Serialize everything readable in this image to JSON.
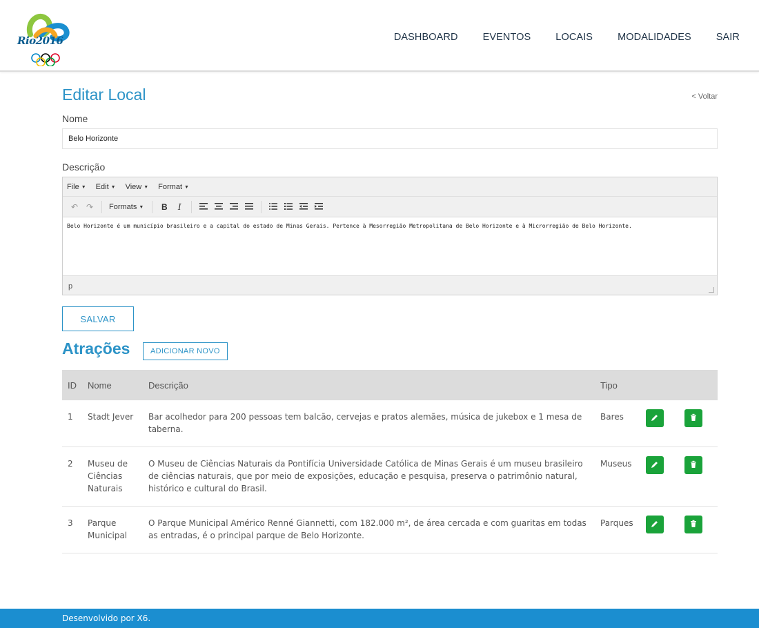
{
  "header": {
    "logo_text": "Rio2016",
    "nav": [
      "DASHBOARD",
      "EVENTOS",
      "LOCAIS",
      "MODALIDADES",
      "SAIR"
    ]
  },
  "page": {
    "title": "Editar Local",
    "back_label": "< Voltar"
  },
  "form": {
    "name_label": "Nome",
    "name_value": "Belo Horizonte",
    "description_label": "Descrição",
    "save_label": "SALVAR"
  },
  "editor": {
    "menus": [
      "File",
      "Edit",
      "View",
      "Format"
    ],
    "formats_label": "Formats",
    "bold_label": "B",
    "italic_label": "I",
    "content": "Belo Horizonte é um município brasileiro e a capital do estado de Minas Gerais. Pertence à Mesorregião Metropolitana de Belo Horizonte e à Microrregião de Belo Horizonte.",
    "status_path": "p"
  },
  "attractions": {
    "title": "Atrações",
    "add_label": "ADICIONAR NOVO",
    "columns": [
      "ID",
      "Nome",
      "Descrição",
      "Tipo"
    ],
    "rows": [
      {
        "id": "1",
        "name": "Stadt Jever",
        "description": "Bar acolhedor para 200 pessoas tem balcão, cervejas e pratos alemães, música de jukebox e 1 mesa de taberna.",
        "type": "Bares"
      },
      {
        "id": "2",
        "name": "Museu de Ciências Naturais",
        "description": "O Museu de Ciências Naturais da Pontifícia Universidade Católica de Minas Gerais é um museu brasileiro de ciências naturais, que por meio de exposições, educação e pesquisa, preserva o patrimônio natural, histórico e cultural do Brasil.",
        "type": "Museus"
      },
      {
        "id": "3",
        "name": "Parque Municipal",
        "description": "O Parque Municipal Américo Renné Giannetti, com 182.000 m², de área cercada e com guaritas em todas as entradas, é o principal parque de Belo Horizonte.",
        "type": "Parques"
      }
    ]
  },
  "footer": {
    "text": "Desenvolvido por X6."
  },
  "colors": {
    "accent": "#2c93c7",
    "action_green": "#1aa33a",
    "footer_blue": "#1b8ed0"
  }
}
